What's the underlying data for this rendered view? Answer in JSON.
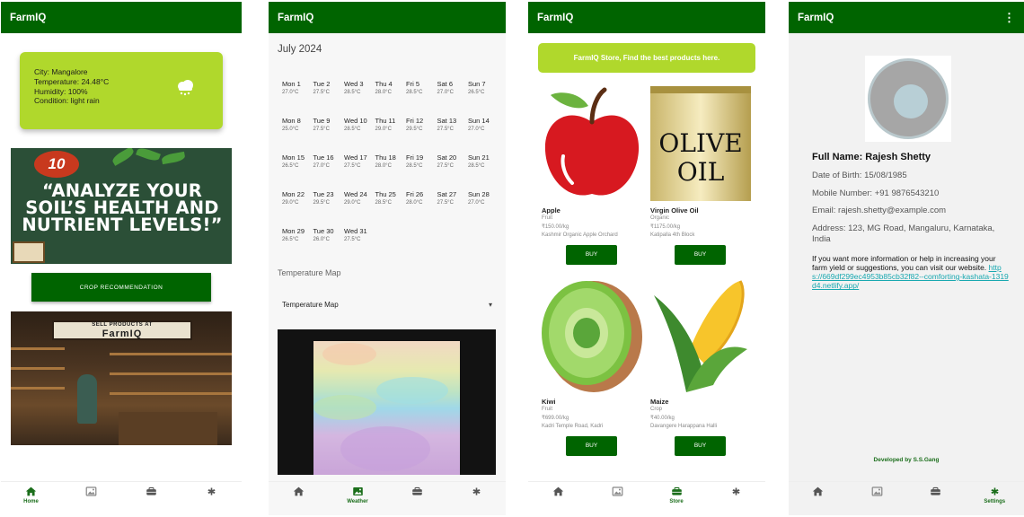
{
  "app_title": "FarmIQ",
  "nav": {
    "home": "Home",
    "weather": "Weather",
    "store": "Store",
    "settings": "Settings"
  },
  "home": {
    "weather": {
      "city": "City: Mangalore",
      "temperature": "Temperature: 24.48°C",
      "humidity": "Humidity: 100%",
      "condition": "Condition: light rain"
    },
    "banner": {
      "number": "10",
      "text": "“ANALYZE YOUR SOIL’S HEALTH AND NUTRIENT LEVELS!”"
    },
    "crop_button": "CROP RECOMMENDATION",
    "store_sign_top": "SELL PRODUCTS AT",
    "store_sign_main": "FarmIQ"
  },
  "weather": {
    "month": "July 2024",
    "days": [
      {
        "d": "Mon 1",
        "t": "27.0°C"
      },
      {
        "d": "Tue 2",
        "t": "27.5°C"
      },
      {
        "d": "Wed 3",
        "t": "28.5°C"
      },
      {
        "d": "Thu 4",
        "t": "28.0°C"
      },
      {
        "d": "Fri 5",
        "t": "28.5°C"
      },
      {
        "d": "Sat 6",
        "t": "27.0°C"
      },
      {
        "d": "Sun 7",
        "t": "26.5°C"
      },
      {
        "d": "Mon 8",
        "t": "25.0°C"
      },
      {
        "d": "Tue 9",
        "t": "27.5°C"
      },
      {
        "d": "Wed 10",
        "t": "28.5°C"
      },
      {
        "d": "Thu 11",
        "t": "29.0°C"
      },
      {
        "d": "Fri 12",
        "t": "29.5°C"
      },
      {
        "d": "Sat 13",
        "t": "27.5°C"
      },
      {
        "d": "Sun 14",
        "t": "27.0°C"
      },
      {
        "d": "Mon 15",
        "t": "26.5°C"
      },
      {
        "d": "Tue 16",
        "t": "27.0°C"
      },
      {
        "d": "Wed 17",
        "t": "27.5°C"
      },
      {
        "d": "Thu 18",
        "t": "28.0°C"
      },
      {
        "d": "Fri 19",
        "t": "28.5°C"
      },
      {
        "d": "Sat 20",
        "t": "27.5°C"
      },
      {
        "d": "Sun 21",
        "t": "28.5°C"
      },
      {
        "d": "Mon 22",
        "t": "29.0°C"
      },
      {
        "d": "Tue 23",
        "t": "29.5°C"
      },
      {
        "d": "Wed 24",
        "t": "29.0°C"
      },
      {
        "d": "Thu 25",
        "t": "28.5°C"
      },
      {
        "d": "Fri 26",
        "t": "28.0°C"
      },
      {
        "d": "Sat 27",
        "t": "27.5°C"
      },
      {
        "d": "Sun 28",
        "t": "27.0°C"
      },
      {
        "d": "Mon 29",
        "t": "26.5°C"
      },
      {
        "d": "Tue 30",
        "t": "26.0°C"
      },
      {
        "d": "Wed 31",
        "t": "27.5°C"
      }
    ],
    "map_section_label": "Temperature Map",
    "map_select_value": "Temperature Map"
  },
  "store": {
    "banner": "FarmIQ Store, Find the best products here.",
    "buy_label": "BUY",
    "products": [
      {
        "name": "Apple",
        "category": "Fruit",
        "price": "₹150.00/kg",
        "seller": "Kashmir Organic Apple Orchard"
      },
      {
        "name": "Virgin Olive Oil",
        "category": "Organic",
        "price": "₹1175.00/kg",
        "seller": "Katipalla 4th Block"
      },
      {
        "name": "Kiwi",
        "category": "Fruit",
        "price": "₹699.00/kg",
        "seller": "Kadri Temple Road, Kadri"
      },
      {
        "name": "Maize",
        "category": "Crop",
        "price": "₹40.00/kg",
        "seller": "Davangere Harappana Halli"
      }
    ],
    "olive_label_1": "OLIVE",
    "olive_label_2": "OIL"
  },
  "settings": {
    "full_name": "Full Name: Rajesh Shetty",
    "dob": "Date of Birth: 15/08/1985",
    "mobile": "Mobile Number: +91 9876543210",
    "email": "Email: rajesh.shetty@example.com",
    "address": "Address: 123, MG Road, Mangaluru, Karnataka, India",
    "info_text": "If you want more information or help in increasing your farm yield or suggestions, you can visit our website.",
    "link": "https://669df299ec4953b85cb32f82--comforting-kashata-1319d4.netlify.app/",
    "developer": "Developed by S.S.Gang"
  },
  "colors": {
    "primary": "#006400",
    "accent": "#b0d82c",
    "link": "#18a8b0"
  }
}
